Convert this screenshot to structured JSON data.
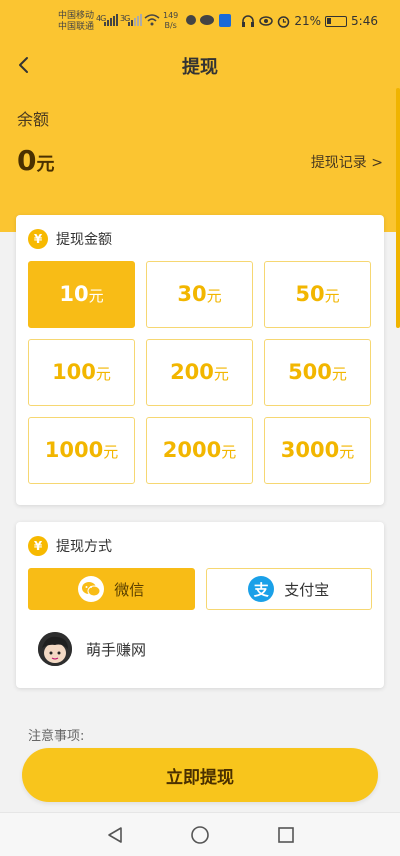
{
  "status_bar": {
    "carrier_1": "中国移动",
    "carrier_2": "中国联通",
    "signal_1": "4G",
    "signal_2": "3G",
    "net_speed_value": "149",
    "net_speed_unit": "B/s",
    "battery": "21%",
    "time": "5:46"
  },
  "nav": {
    "title": "提现"
  },
  "balance": {
    "label": "余额",
    "value": "0",
    "unit": "元",
    "records_link": "提现记录 >"
  },
  "amount_section": {
    "title": "提现金额",
    "badge": "¥",
    "options": [
      {
        "num": "10",
        "unit": "元",
        "selected": true
      },
      {
        "num": "30",
        "unit": "元",
        "selected": false
      },
      {
        "num": "50",
        "unit": "元",
        "selected": false
      },
      {
        "num": "100",
        "unit": "元",
        "selected": false
      },
      {
        "num": "200",
        "unit": "元",
        "selected": false
      },
      {
        "num": "500",
        "unit": "元",
        "selected": false
      },
      {
        "num": "1000",
        "unit": "元",
        "selected": false
      },
      {
        "num": "2000",
        "unit": "元",
        "selected": false
      },
      {
        "num": "3000",
        "unit": "元",
        "selected": false
      }
    ]
  },
  "method_section": {
    "title": "提现方式",
    "badge": "¥",
    "wechat_label": "微信",
    "alipay_label": "支付宝",
    "alipay_glyph": "支",
    "account_name": "萌手赚网"
  },
  "notes": {
    "label": "注意事项:"
  },
  "submit": {
    "label": "立即提现"
  },
  "colors": {
    "accent": "#f8bc16",
    "hero": "#fbc531",
    "amount_text": "#f2b600",
    "alipay_blue": "#1aa0e8"
  },
  "icons": [
    "back-arrow-icon",
    "yen-icon",
    "wechat-icon",
    "alipay-icon",
    "avatar",
    "sys-back-icon",
    "sys-home-icon",
    "sys-recent-icon"
  ]
}
